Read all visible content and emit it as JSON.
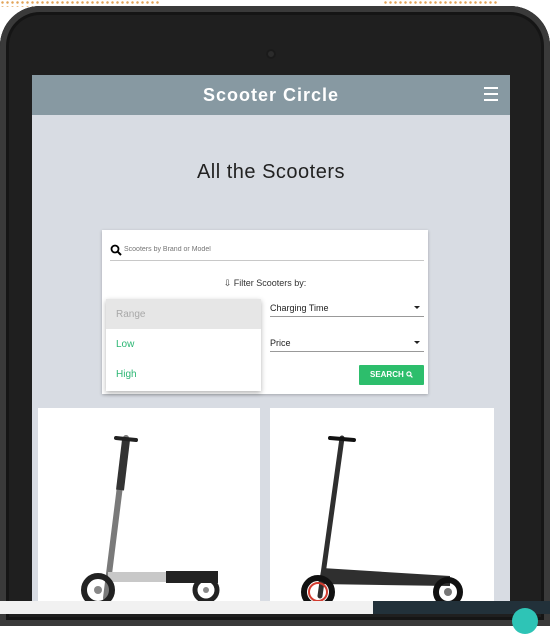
{
  "navbar": {
    "brand": "Scooter Circle"
  },
  "main": {
    "title": "All the Scooters"
  },
  "filters": {
    "search_placeholder": "Scooters by Brand or Model",
    "filter_label": "⇩ Filter Scooters by:",
    "range": {
      "label": "Range",
      "options": [
        "Low",
        "High"
      ]
    },
    "charging_time": "Charging Time",
    "price": "Price",
    "search_button": "SEARCH"
  },
  "colors": {
    "navbar": "#8799a2",
    "page_bg": "#d8dce3",
    "search_button": "#2dbe6c",
    "option_text": "#2bb673"
  },
  "icons": {
    "search": "search-icon",
    "menu": "hamburger-icon",
    "filter": "sort-icon"
  }
}
